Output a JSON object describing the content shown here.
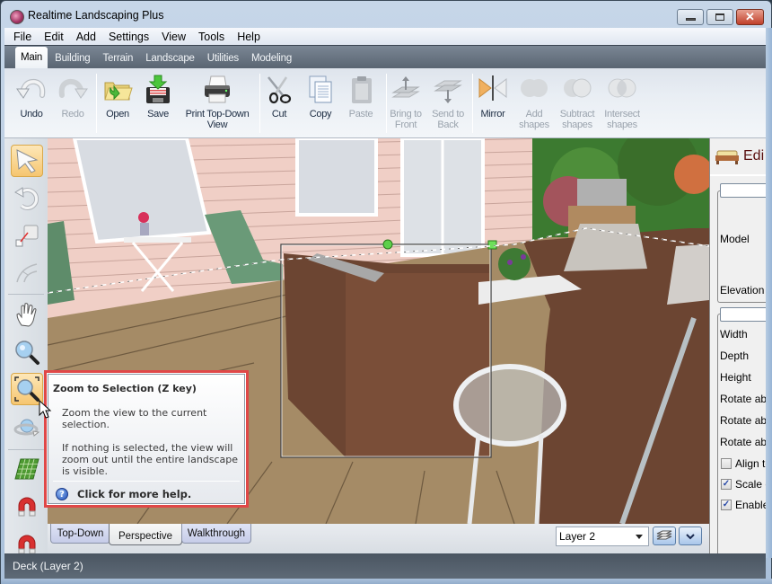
{
  "window": {
    "title": "Realtime Landscaping Plus",
    "controls": {
      "minimize": "minimize",
      "maximize": "maximize",
      "close": "close"
    }
  },
  "menu": [
    "File",
    "Edit",
    "Add",
    "Settings",
    "View",
    "Tools",
    "Help"
  ],
  "ribbon_tabs": [
    {
      "label": "Main",
      "active": true
    },
    {
      "label": "Building",
      "active": false
    },
    {
      "label": "Terrain",
      "active": false
    },
    {
      "label": "Landscape",
      "active": false
    },
    {
      "label": "Utilities",
      "active": false
    },
    {
      "label": "Modeling",
      "active": false
    }
  ],
  "toolbar": {
    "undo": {
      "label": "Undo",
      "icon": "undo-icon",
      "enabled": true
    },
    "redo": {
      "label": "Redo",
      "icon": "redo-icon",
      "enabled": false
    },
    "open": {
      "label": "Open",
      "icon": "folder-open-icon",
      "enabled": true
    },
    "save": {
      "label": "Save",
      "icon": "floppy-save-icon",
      "enabled": true
    },
    "print": {
      "label": "Print Top-Down View",
      "line1": "Print Top-Down",
      "line2": "View",
      "icon": "printer-icon",
      "enabled": true
    },
    "cut": {
      "label": "Cut",
      "icon": "scissors-icon",
      "enabled": true
    },
    "copy": {
      "label": "Copy",
      "icon": "copy-icon",
      "enabled": true
    },
    "paste": {
      "label": "Paste",
      "icon": "clipboard-paste-icon",
      "enabled": false
    },
    "bring_front": {
      "line1": "Bring to",
      "line2": "Front",
      "icon": "bring-to-front-icon",
      "enabled": false
    },
    "send_back": {
      "line1": "Send to",
      "line2": "Back",
      "icon": "send-to-back-icon",
      "enabled": false
    },
    "mirror": {
      "label": "Mirror",
      "icon": "mirror-icon",
      "enabled": true
    },
    "add_shapes": {
      "line1": "Add",
      "line2": "shapes",
      "icon": "add-shapes-icon",
      "enabled": false
    },
    "subtract_shapes": {
      "line1": "Subtract",
      "line2": "shapes",
      "icon": "subtract-shapes-icon",
      "enabled": false
    },
    "intersect_shapes": {
      "line1": "Intersect",
      "line2": "shapes",
      "icon": "intersect-shapes-icon",
      "enabled": false
    }
  },
  "tools": [
    {
      "name": "select-tool",
      "icon": "arrow-cursor-icon",
      "active": true
    },
    {
      "name": "rotate-tool",
      "icon": "rotate-icon",
      "active": false
    },
    {
      "name": "resize-tool",
      "icon": "resize-icon",
      "active": false
    },
    {
      "name": "arc-tool",
      "icon": "arc-icon",
      "active": false
    },
    {
      "name": "pan-tool",
      "icon": "hand-icon",
      "active": false
    },
    {
      "name": "zoom-tool",
      "icon": "magnifier-icon",
      "active": false
    },
    {
      "name": "zoom-to-selection-tool",
      "icon": "zoom-selection-icon",
      "active": true
    },
    {
      "name": "orbit-tool",
      "icon": "orbit-icon",
      "active": false
    },
    {
      "name": "grid-tool",
      "icon": "grid-icon",
      "active": false
    },
    {
      "name": "snap-tool",
      "icon": "magnet-icon",
      "active": false
    },
    {
      "name": "snap-tool-2",
      "icon": "magnet-icon",
      "active": false
    }
  ],
  "tooltip": {
    "title": "Zoom to Selection (Z key)",
    "body1_line1": "Zoom the view to the current",
    "body1_line2": "selection.",
    "body2_line1": "If nothing is selected, the view will",
    "body2_line2": "zoom out until the entire landscape",
    "body2_line3": "is visible.",
    "help": "Click for more help."
  },
  "view_tabs": [
    {
      "label": "Top-Down",
      "active": false
    },
    {
      "label": "Perspective",
      "active": true
    },
    {
      "label": "Walkthrough",
      "active": false
    }
  ],
  "layer": {
    "selected": "Layer 2"
  },
  "right_panel": {
    "title": "Edi",
    "labels": {
      "model": "Model",
      "elevation": "Elevation",
      "width": "Width",
      "depth": "Depth",
      "height": "Height",
      "rotate1": "Rotate abo",
      "rotate2": "Rotate abo",
      "rotate3": "Rotate abo"
    },
    "checkboxes": [
      {
        "label": "Align to",
        "checked": false
      },
      {
        "label": "Scale e",
        "checked": true
      },
      {
        "label": "Enable",
        "checked": true
      }
    ]
  },
  "status": {
    "text": "Deck (Layer 2)"
  }
}
